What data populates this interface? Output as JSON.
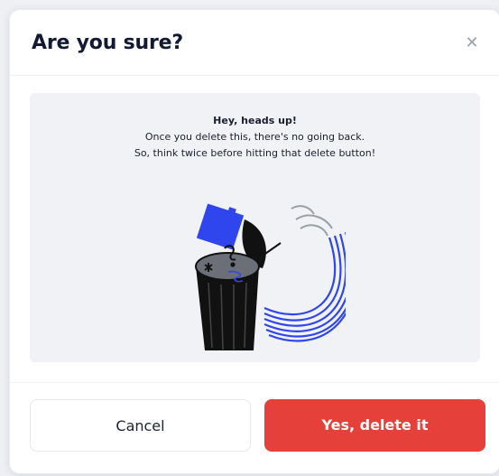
{
  "dialog": {
    "title": "Are you sure?",
    "close_icon": "close-icon",
    "message": {
      "heading": "Hey, heads up!",
      "line1": "Once you delete this, there's no going back.",
      "line2": "So, think twice before hitting that delete button!"
    },
    "buttons": {
      "cancel_label": "Cancel",
      "delete_label": "Yes, delete it"
    },
    "colors": {
      "danger": "#e5403a",
      "illustration_accent": "#2f46ee",
      "title": "#121a33"
    }
  }
}
